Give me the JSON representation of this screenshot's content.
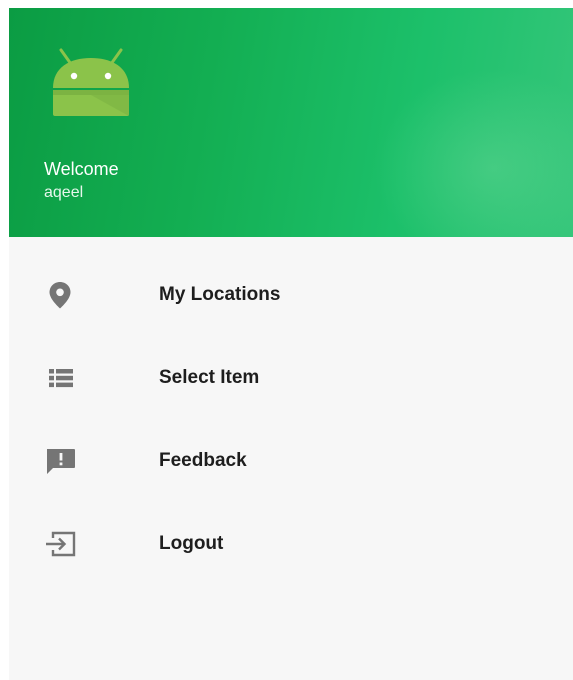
{
  "header": {
    "avatar_icon": "android-robot-icon",
    "welcome": "Welcome",
    "username": "aqeel",
    "colors": {
      "gradient_start": "#0b9c43",
      "gradient_end": "#35c67a",
      "avatar": "#8bc34a"
    }
  },
  "menu": {
    "items": [
      {
        "label": "My Locations",
        "icon": "location-pin-icon"
      },
      {
        "label": "Select Item",
        "icon": "list-icon"
      },
      {
        "label": "Feedback",
        "icon": "feedback-icon"
      },
      {
        "label": "Logout",
        "icon": "logout-icon"
      }
    ],
    "icon_color": "#757575"
  }
}
